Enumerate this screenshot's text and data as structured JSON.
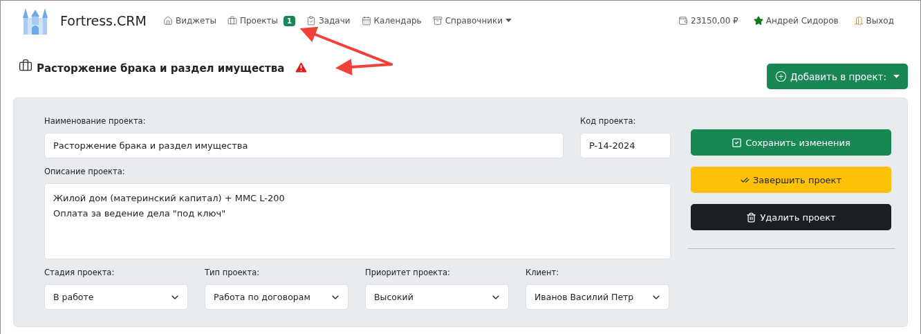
{
  "brand": {
    "name": "Fortress.CRM"
  },
  "nav": [
    {
      "label": "Виджеты"
    },
    {
      "label": "Проекты",
      "badge": "1"
    },
    {
      "label": "Задачи"
    },
    {
      "label": "Календарь"
    },
    {
      "label": "Справочники",
      "has_menu": true
    }
  ],
  "account": {
    "balance": "23150,00 ₽",
    "user": "Андрей Сидоров",
    "logout": "Выход"
  },
  "page": {
    "title": "Расторжение брака и раздел имущества",
    "warning": true,
    "add_button": "Добавить в проект:"
  },
  "form": {
    "name": {
      "label": "Наименование проекта:",
      "value": "Расторжение брака и раздел имущества"
    },
    "code": {
      "label": "Код проекта:",
      "value": "P-14-2024"
    },
    "description": {
      "label": "Описание проекта:",
      "lines": [
        "Жилой дом (материнский капитал) + MMC L-200",
        "Оплата за ведение дела \"под ключ\""
      ]
    },
    "selects": [
      {
        "label": "Стадия проекта:",
        "value": "В работе"
      },
      {
        "label": "Тип проекта:",
        "value": "Работа по договорам"
      },
      {
        "label": "Приоритет проекта:",
        "value": "Высокий"
      },
      {
        "label": "Клиент:",
        "value": "Иванов Василий Петр"
      }
    ]
  },
  "actions": [
    {
      "label": "Сохранить изменения",
      "kind": "save"
    },
    {
      "label": "Завершить проект",
      "kind": "finish"
    },
    {
      "label": "Удалить проект",
      "kind": "delete"
    }
  ]
}
